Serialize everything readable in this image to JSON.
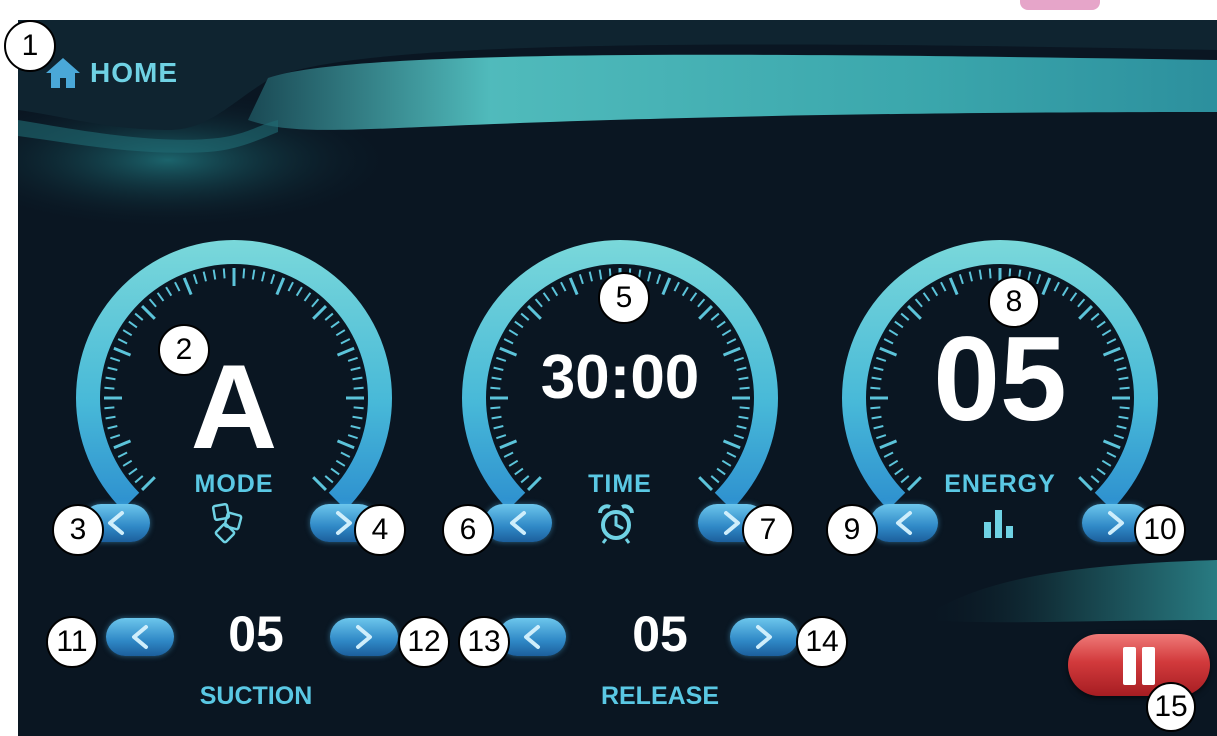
{
  "header": {
    "home_label": "HOME"
  },
  "gauges": [
    {
      "value": "A",
      "label": "MODE",
      "icon": "cubes-icon"
    },
    {
      "value": "30:00",
      "label": "TIME",
      "icon": "alarm-clock-icon"
    },
    {
      "value": "05",
      "label": "ENERGY",
      "icon": "bar-chart-icon"
    }
  ],
  "suction": {
    "value": "05",
    "label": "SUCTION"
  },
  "release": {
    "value": "05",
    "label": "RELEASE"
  },
  "callouts": [
    "1",
    "2",
    "3",
    "4",
    "5",
    "6",
    "7",
    "8",
    "9",
    "10",
    "11",
    "12",
    "13",
    "14",
    "15"
  ],
  "colors": {
    "accent": "#4fc3dd",
    "background": "#0a1622",
    "value_text": "#ffffff",
    "label_text": "#5ac8e4",
    "pause_button": "#d23a3c",
    "button_blue": "#2f88c6"
  }
}
